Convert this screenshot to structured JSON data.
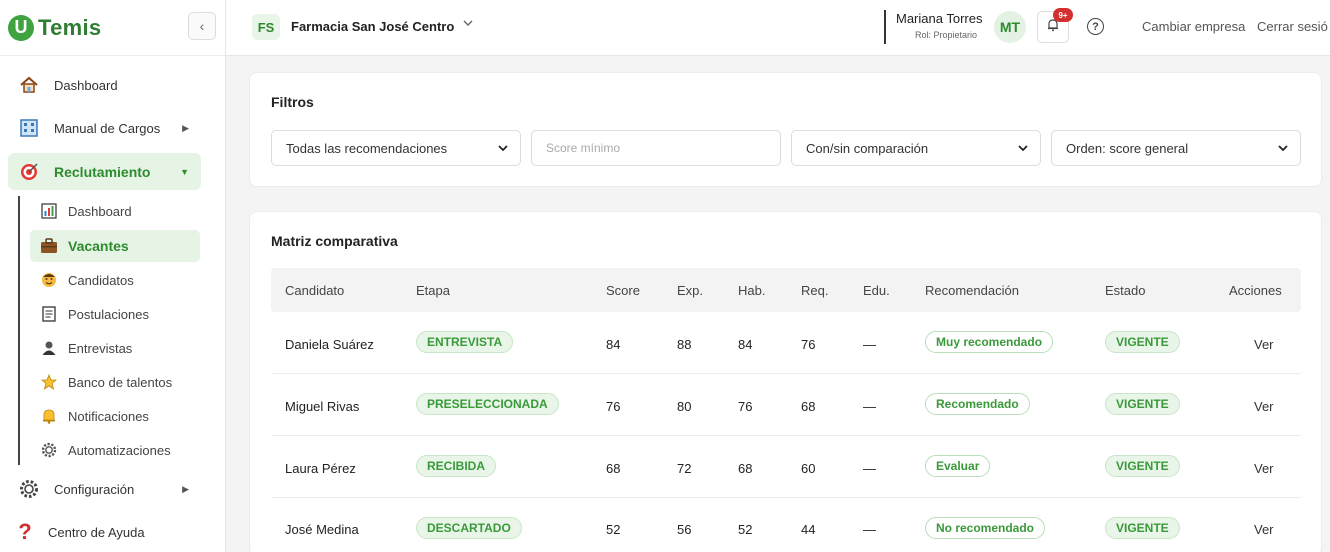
{
  "brand": {
    "name": "Temis",
    "mark": "U"
  },
  "sidebar": {
    "collapse_icon": "chevron-left-icon",
    "items": [
      {
        "label": "Dashboard",
        "icon": "house-icon"
      },
      {
        "label": "Manual de Cargos",
        "icon": "building-icon"
      },
      {
        "label": "Reclutamiento",
        "icon": "target-icon"
      },
      {
        "label": "Configuración",
        "icon": "gear-icon"
      },
      {
        "label": "Centro de Ayuda",
        "icon": "question-icon"
      }
    ],
    "sub_items": [
      {
        "label": "Dashboard",
        "icon": "bar-chart-icon"
      },
      {
        "label": "Vacantes",
        "icon": "briefcase-icon"
      },
      {
        "label": "Candidatos",
        "icon": "face-icon"
      },
      {
        "label": "Postulaciones",
        "icon": "document-icon"
      },
      {
        "label": "Entrevistas",
        "icon": "person-icon"
      },
      {
        "label": "Banco de talentos",
        "icon": "star-icon"
      },
      {
        "label": "Notificaciones",
        "icon": "bell-icon"
      },
      {
        "label": "Automatizaciones",
        "icon": "cog-icon"
      }
    ]
  },
  "header": {
    "company_initials": "FS",
    "company_name": "Farmacia San José Centro",
    "user_name": "Mariana Torres",
    "user_role": "Rol: Propietario",
    "avatar_initials": "MT",
    "notification_badge": "9+",
    "change_company": "Cambiar empresa",
    "logout": "Cerrar sesió"
  },
  "filters": {
    "title": "Filtros",
    "recommendation_select": "Todas las recomendaciones",
    "min_score_placeholder": "Score mínimo",
    "comparison_select": "Con/sin comparación",
    "order_select": "Orden: score general"
  },
  "matrix": {
    "title": "Matriz comparativa",
    "columns": [
      "Candidato",
      "Etapa",
      "Score",
      "Exp.",
      "Hab.",
      "Req.",
      "Edu.",
      "Recomendación",
      "Estado",
      "Acciones"
    ],
    "rows": [
      {
        "candidate": "Daniela Suárez",
        "stage": "ENTREVISTA",
        "score": "84",
        "exp": "88",
        "hab": "84",
        "req": "76",
        "edu": "—",
        "recommendation": "Muy recomendado",
        "state": "VIGENTE",
        "action": "Ver"
      },
      {
        "candidate": "Miguel Rivas",
        "stage": "PRESELECCIONADA",
        "score": "76",
        "exp": "80",
        "hab": "76",
        "req": "68",
        "edu": "—",
        "recommendation": "Recomendado",
        "state": "VIGENTE",
        "action": "Ver"
      },
      {
        "candidate": "Laura Pérez",
        "stage": "RECIBIDA",
        "score": "68",
        "exp": "72",
        "hab": "68",
        "req": "60",
        "edu": "—",
        "recommendation": "Evaluar",
        "state": "VIGENTE",
        "action": "Ver"
      },
      {
        "candidate": "José Medina",
        "stage": "DESCARTADO",
        "score": "52",
        "exp": "56",
        "hab": "52",
        "req": "44",
        "edu": "—",
        "recommendation": "No recomendado",
        "state": "VIGENTE",
        "action": "Ver"
      }
    ]
  },
  "colors": {
    "accent": "#2e8b2e",
    "accent_bg": "#e6f4e6",
    "badge": "#d32f2f"
  }
}
